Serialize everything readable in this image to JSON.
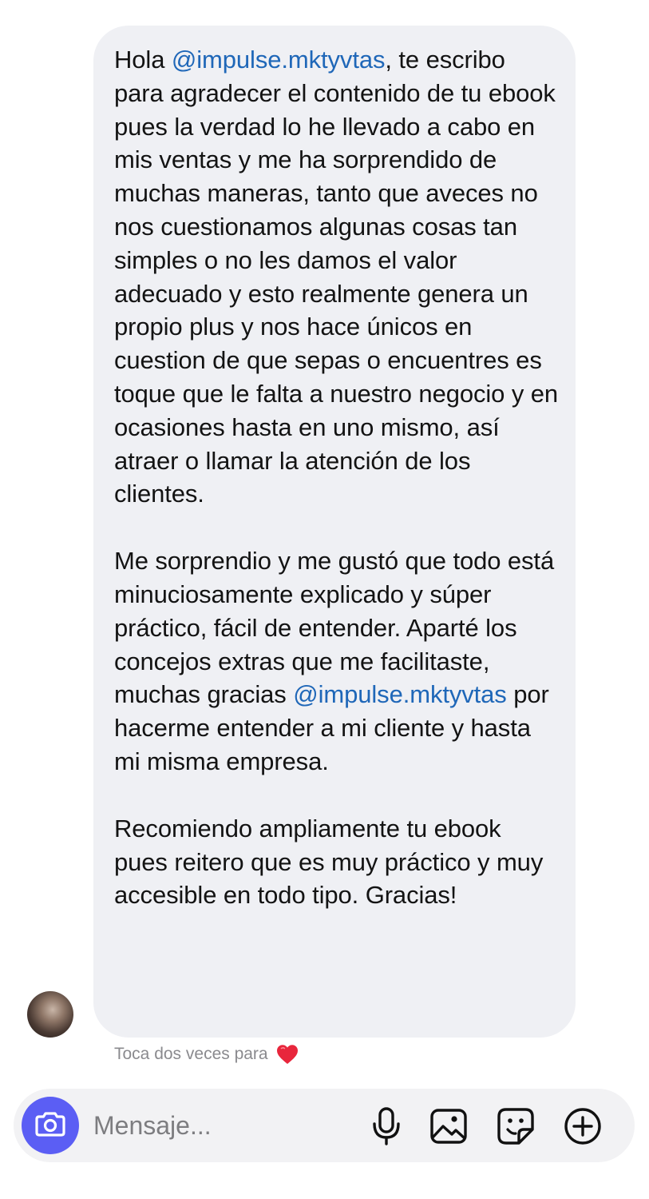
{
  "message": {
    "paragraphs": [
      [
        {
          "text": "Hola ",
          "mention": false
        },
        {
          "text": "@impulse.mktyvtas",
          "mention": true
        },
        {
          "text": ", te escribo para agradecer el contenido de tu ebook pues la verdad lo he llevado a cabo en mis ventas y me ha sorprendido de muchas maneras, tanto que aveces no nos cuestionamos algunas cosas tan simples o no les damos el valor adecuado y esto realmente genera un propio plus y nos hace únicos en cuestion de que sepas o encuentres es toque que le falta a nuestro negocio y en ocasiones hasta en uno mismo, así atraer o llamar la atención de los clientes.",
          "mention": false
        }
      ],
      [
        {
          "text": "Me sorprendio y me gustó que todo está minuciosamente explicado y súper práctico, fácil de entender. Aparté los concejos extras que me facilitaste, muchas gracias ",
          "mention": false
        },
        {
          "text": "@impulse.mktyvtas",
          "mention": true
        },
        {
          "text": " por hacerme entender a mi cliente y hasta mi misma empresa.",
          "mention": false
        }
      ],
      [
        {
          "text": "Recomiendo ampliamente tu ebook pues reitero que es muy práctico y muy accesible en todo tipo. Gracias!",
          "mention": false
        }
      ]
    ]
  },
  "hint": {
    "text": "Toca dos veces para",
    "icon": "heart-icon"
  },
  "composer": {
    "placeholder": "Mensaje...",
    "icons": [
      "camera-icon",
      "microphone-icon",
      "image-icon",
      "sticker-icon",
      "plus-circle-icon"
    ]
  },
  "colors": {
    "bubble": "#eff0f4",
    "mention": "#1f67b8",
    "camera_button": "#5b5ef4",
    "heart": "#e8263c",
    "hint_text": "#8a8a8e"
  }
}
